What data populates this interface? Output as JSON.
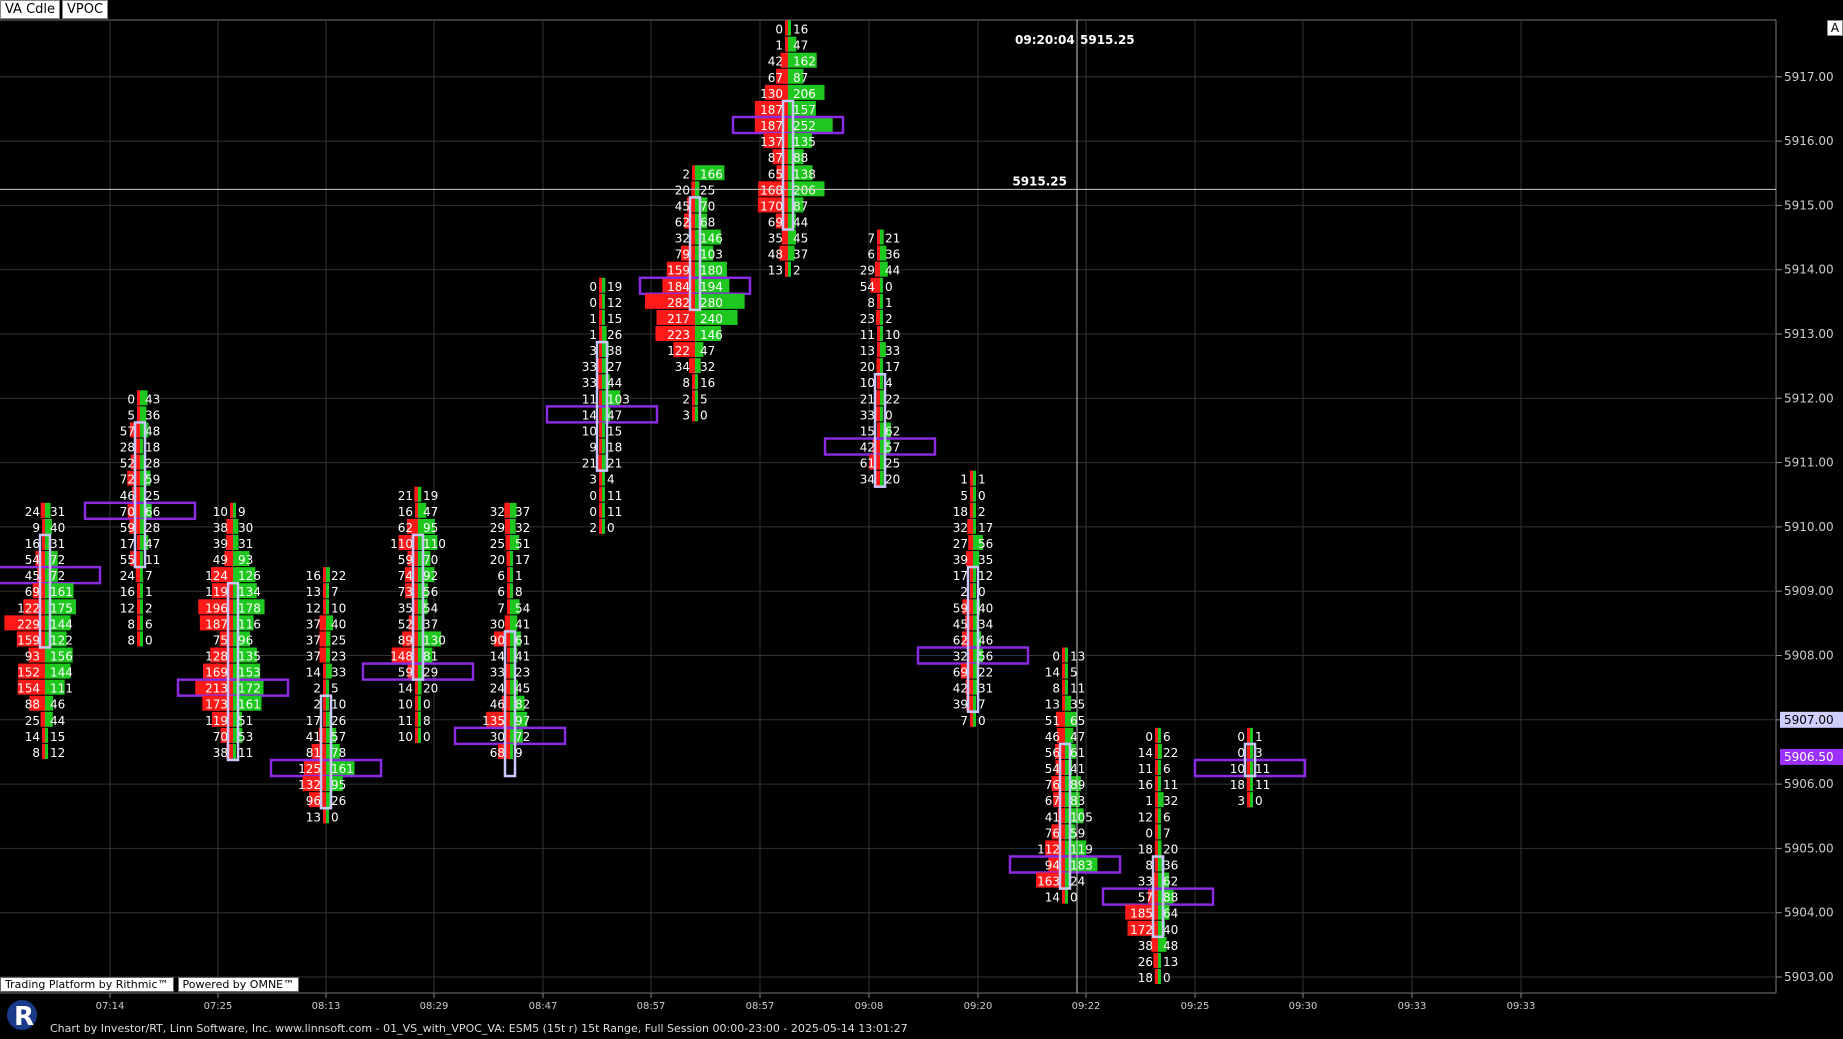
{
  "tabs": [
    {
      "label": "VA Cdle"
    },
    {
      "label": "VPOC"
    }
  ],
  "corner_button": "A",
  "branding": {
    "rithmic": "Trading Platform by Rithmic™",
    "omne": "Powered by OMNE™"
  },
  "footer": "Chart by Investor/RT, Linn Software, Inc. www.linnsoft.com - 01_VS_with_VPOC_VA: ESM5 (15t r) 15t Range, Full Session 00:00-23:00 - 2025-05-14 13:01:27",
  "crosshair": {
    "time_label": "09:20:04",
    "price_label": "5915.25",
    "price": 5915.25
  },
  "price_markers": [
    {
      "text": "5907.00",
      "color": "#cfcfff"
    },
    {
      "text": "5906.50",
      "color": "#9b30ff"
    }
  ],
  "colors": {
    "bid": "#ff1a1a",
    "ask": "#1ec81e",
    "vpoc": "#8a2be2",
    "va_box": "#c8c8ff",
    "grid": "#333333",
    "axis_text": "#cccccc"
  },
  "chart_data": {
    "type": "volume_footprint",
    "tick_size": 0.25,
    "y_ticks": [
      "5903.00",
      "5904.00",
      "5905.00",
      "5906.00",
      "5907.00",
      "5908.00",
      "5909.00",
      "5910.00",
      "5911.00",
      "5912.00",
      "5913.00",
      "5914.00",
      "5915.00",
      "5916.00",
      "5917.00"
    ],
    "x_ticks": [
      "07:14",
      "07:25",
      "08:13",
      "08:29",
      "08:47",
      "08:57",
      "08:57",
      "09:08",
      "09:20",
      "09:22",
      "09:25",
      "09:30",
      "09:33",
      "09:33"
    ],
    "bars": [
      {
        "hi": 5910.25,
        "poc": 5909.25,
        "va": [
          5908.25,
          5909.75
        ],
        "levels": [
          [
            24,
            31
          ],
          [
            9,
            40
          ],
          [
            16,
            31
          ],
          [
            54,
            72
          ],
          [
            45,
            72
          ],
          [
            69,
            161
          ],
          [
            122,
            175
          ],
          [
            229,
            144
          ],
          [
            159,
            122
          ],
          [
            93,
            156
          ],
          [
            152,
            144
          ],
          [
            154,
            111
          ],
          [
            88,
            46
          ],
          [
            25,
            44
          ],
          [
            14,
            15
          ],
          [
            8,
            12
          ]
        ]
      },
      {
        "hi": 5912.0,
        "poc": 5910.25,
        "va": [
          5909.5,
          5911.5
        ],
        "levels": [
          [
            0,
            43
          ],
          [
            5,
            36
          ],
          [
            57,
            48
          ],
          [
            28,
            18
          ],
          [
            52,
            28
          ],
          [
            72,
            59
          ],
          [
            46,
            25
          ],
          [
            70,
            66
          ],
          [
            59,
            28
          ],
          [
            17,
            47
          ],
          [
            55,
            11
          ],
          [
            24,
            7
          ],
          [
            16,
            1
          ],
          [
            12,
            2
          ],
          [
            8,
            6
          ],
          [
            8,
            0
          ]
        ]
      },
      {
        "hi": 5910.25,
        "poc": 5907.5,
        "va": [
          5906.5,
          5909.0
        ],
        "levels": [
          [
            10,
            9
          ],
          [
            38,
            30
          ],
          [
            39,
            31
          ],
          [
            49,
            93
          ],
          [
            124,
            126
          ],
          [
            119,
            134
          ],
          [
            196,
            178
          ],
          [
            187,
            116
          ],
          [
            75,
            96
          ],
          [
            128,
            135
          ],
          [
            169,
            153
          ],
          [
            213,
            172
          ],
          [
            173,
            161
          ],
          [
            119,
            51
          ],
          [
            70,
            53
          ],
          [
            38,
            11
          ]
        ]
      },
      {
        "hi": 5909.25,
        "poc": 5906.25,
        "va": [
          5905.75,
          5907.25
        ],
        "levels": [
          [
            16,
            22
          ],
          [
            13,
            7
          ],
          [
            12,
            10
          ],
          [
            37,
            40
          ],
          [
            37,
            25
          ],
          [
            37,
            23
          ],
          [
            14,
            33
          ],
          [
            2,
            5
          ],
          [
            2,
            10
          ],
          [
            17,
            26
          ],
          [
            41,
            57
          ],
          [
            81,
            78
          ],
          [
            125,
            161
          ],
          [
            132,
            95
          ],
          [
            96,
            26
          ],
          [
            13,
            0
          ]
        ]
      },
      {
        "hi": 5910.5,
        "poc": 5907.75,
        "va": [
          5907.75,
          5909.75
        ],
        "levels": [
          [
            21,
            19
          ],
          [
            16,
            47
          ],
          [
            62,
            95
          ],
          [
            110,
            110
          ],
          [
            59,
            70
          ],
          [
            74,
            92
          ],
          [
            73,
            56
          ],
          [
            35,
            54
          ],
          [
            52,
            37
          ],
          [
            89,
            130
          ],
          [
            148,
            81
          ],
          [
            59,
            29
          ],
          [
            14,
            20
          ],
          [
            10,
            0
          ],
          [
            11,
            8
          ],
          [
            10,
            0
          ]
        ]
      },
      {
        "hi": 5910.25,
        "poc": 5906.75,
        "va": [
          5906.25,
          5908.25
        ],
        "levels": [
          [
            32,
            37
          ],
          [
            29,
            32
          ],
          [
            25,
            51
          ],
          [
            20,
            17
          ],
          [
            6,
            1
          ],
          [
            6,
            8
          ],
          [
            7,
            54
          ],
          [
            30,
            41
          ],
          [
            90,
            61
          ],
          [
            14,
            41
          ],
          [
            33,
            23
          ],
          [
            24,
            45
          ],
          [
            46,
            82
          ],
          [
            135,
            97
          ],
          [
            30,
            72
          ],
          [
            68,
            9
          ]
        ]
      },
      {
        "hi": 5913.75,
        "poc": 5911.75,
        "va": [
          5911.0,
          5912.75
        ],
        "levels": [
          [
            0,
            19
          ],
          [
            0,
            12
          ],
          [
            1,
            15
          ],
          [
            1,
            26
          ],
          [
            3,
            38
          ],
          [
            33,
            27
          ],
          [
            33,
            44
          ],
          [
            11,
            103
          ],
          [
            14,
            47
          ],
          [
            10,
            15
          ],
          [
            9,
            18
          ],
          [
            21,
            21
          ],
          [
            3,
            4
          ],
          [
            0,
            11
          ],
          [
            0,
            11
          ],
          [
            2,
            0
          ]
        ]
      },
      {
        "hi": 5915.5,
        "poc": 5913.75,
        "va": [
          5913.5,
          5915.0
        ],
        "levels": [
          [
            2,
            166
          ],
          [
            20,
            25
          ],
          [
            45,
            70
          ],
          [
            62,
            68
          ],
          [
            32,
            146
          ],
          [
            79,
            103
          ],
          [
            159,
            180
          ],
          [
            184,
            194
          ],
          [
            282,
            280
          ],
          [
            217,
            240
          ],
          [
            223,
            146
          ],
          [
            122,
            47
          ],
          [
            34,
            32
          ],
          [
            8,
            16
          ],
          [
            2,
            5
          ],
          [
            3,
            0
          ]
        ]
      },
      {
        "hi": 5917.75,
        "poc": 5916.25,
        "va": [
          5914.75,
          5916.5
        ],
        "levels": [
          [
            0,
            16
          ],
          [
            1,
            47
          ],
          [
            42,
            162
          ],
          [
            67,
            87
          ],
          [
            130,
            206
          ],
          [
            187,
            157
          ],
          [
            187,
            252
          ],
          [
            137,
            135
          ],
          [
            87,
            88
          ],
          [
            65,
            138
          ],
          [
            168,
            206
          ],
          [
            170,
            87
          ],
          [
            69,
            44
          ],
          [
            35,
            45
          ],
          [
            48,
            37
          ],
          [
            13,
            2
          ]
        ]
      },
      {
        "hi": 5914.5,
        "poc": 5911.25,
        "va": [
          5910.75,
          5912.25
        ],
        "levels": [
          [
            7,
            21
          ],
          [
            6,
            36
          ],
          [
            29,
            44
          ],
          [
            54,
            0
          ],
          [
            8,
            1
          ],
          [
            23,
            2
          ],
          [
            11,
            10
          ],
          [
            13,
            33
          ],
          [
            20,
            17
          ],
          [
            10,
            4
          ],
          [
            21,
            22
          ],
          [
            33,
            0
          ],
          [
            15,
            62
          ],
          [
            42,
            57
          ],
          [
            61,
            25
          ],
          [
            34,
            20
          ]
        ]
      },
      {
        "hi": 5910.75,
        "poc": 5908.0,
        "va": [
          5907.25,
          5909.25
        ],
        "levels": [
          [
            1,
            1
          ],
          [
            5,
            0
          ],
          [
            18,
            2
          ],
          [
            32,
            17
          ],
          [
            27,
            56
          ],
          [
            39,
            35
          ],
          [
            17,
            12
          ],
          [
            2,
            0
          ],
          [
            59,
            40
          ],
          [
            45,
            34
          ],
          [
            62,
            46
          ],
          [
            32,
            56
          ],
          [
            69,
            22
          ],
          [
            42,
            31
          ],
          [
            39,
            7
          ],
          [
            7,
            0
          ]
        ]
      },
      {
        "hi": 5908.0,
        "poc": 5904.75,
        "va": [
          5904.5,
          5906.5
        ],
        "levels": [
          [
            0,
            13
          ],
          [
            14,
            5
          ],
          [
            8,
            11
          ],
          [
            13,
            35
          ],
          [
            51,
            65
          ],
          [
            46,
            47
          ],
          [
            56,
            61
          ],
          [
            54,
            41
          ],
          [
            76,
            89
          ],
          [
            67,
            83
          ],
          [
            41,
            105
          ],
          [
            76,
            59
          ],
          [
            112,
            119
          ],
          [
            94,
            183
          ],
          [
            163,
            24
          ],
          [
            14,
            0
          ]
        ]
      },
      {
        "hi": 5906.75,
        "poc": 5904.25,
        "va": [
          5903.75,
          5904.75
        ],
        "levels": [
          [
            0,
            6
          ],
          [
            14,
            22
          ],
          [
            11,
            6
          ],
          [
            16,
            11
          ],
          [
            1,
            32
          ],
          [
            12,
            6
          ],
          [
            0,
            7
          ],
          [
            18,
            20
          ],
          [
            8,
            36
          ],
          [
            33,
            62
          ],
          [
            57,
            88
          ],
          [
            185,
            64
          ],
          [
            172,
            40
          ],
          [
            38,
            48
          ],
          [
            26,
            13
          ],
          [
            18,
            0
          ]
        ]
      },
      {
        "hi": 5906.75,
        "poc": 5906.25,
        "va": [
          5906.25,
          5906.5
        ],
        "levels": [
          [
            0,
            1
          ],
          [
            0,
            3
          ],
          [
            10,
            11
          ],
          [
            18,
            11
          ],
          [
            3,
            0
          ]
        ]
      }
    ]
  }
}
